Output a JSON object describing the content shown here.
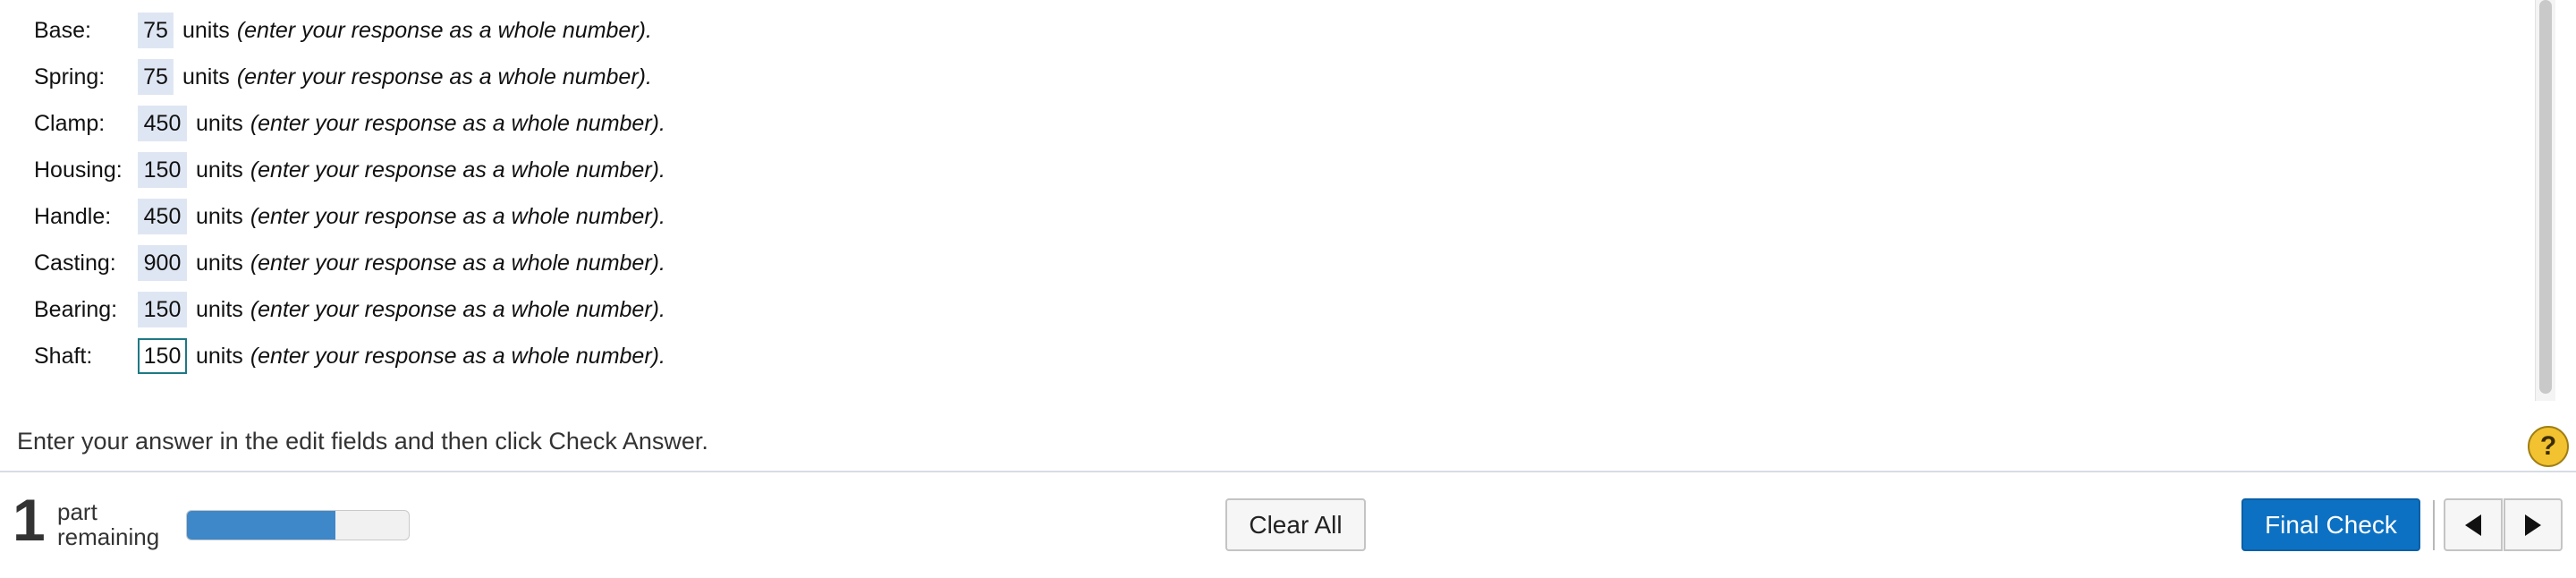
{
  "rows": [
    {
      "label": "Base:",
      "value": "75",
      "units": "units",
      "hint": "(enter your response as a whole number)."
    },
    {
      "label": "Spring:",
      "value": "75",
      "units": "units",
      "hint": "(enter your response as a whole number)."
    },
    {
      "label": "Clamp:",
      "value": "450",
      "units": "units",
      "hint": "(enter your response as a whole number)."
    },
    {
      "label": "Housing:",
      "value": "150",
      "units": "units",
      "hint": "(enter your response as a whole number)."
    },
    {
      "label": "Handle:",
      "value": "450",
      "units": "units",
      "hint": "(enter your response as a whole number)."
    },
    {
      "label": "Casting:",
      "value": "900",
      "units": "units",
      "hint": "(enter your response as a whole number)."
    },
    {
      "label": "Bearing:",
      "value": "150",
      "units": "units",
      "hint": "(enter your response as a whole number)."
    },
    {
      "label": "Shaft:",
      "value": "150",
      "units": "units",
      "hint": "(enter your response as a whole number)."
    }
  ],
  "instruction": "Enter your answer in the edit fields and then click Check Answer.",
  "help_icon": {
    "icon": "question-mark-icon",
    "glyph": "?",
    "color": "#f2c230"
  },
  "footer": {
    "parts_count": "1",
    "parts_line1": "part",
    "parts_line2": "remaining",
    "progress_fraction": 0.67,
    "clear_label": "Clear All",
    "final_label": "Final Check",
    "prev_icon": "triangle-left-icon",
    "next_icon": "triangle-right-icon",
    "accent_color": "#0c71c3"
  }
}
